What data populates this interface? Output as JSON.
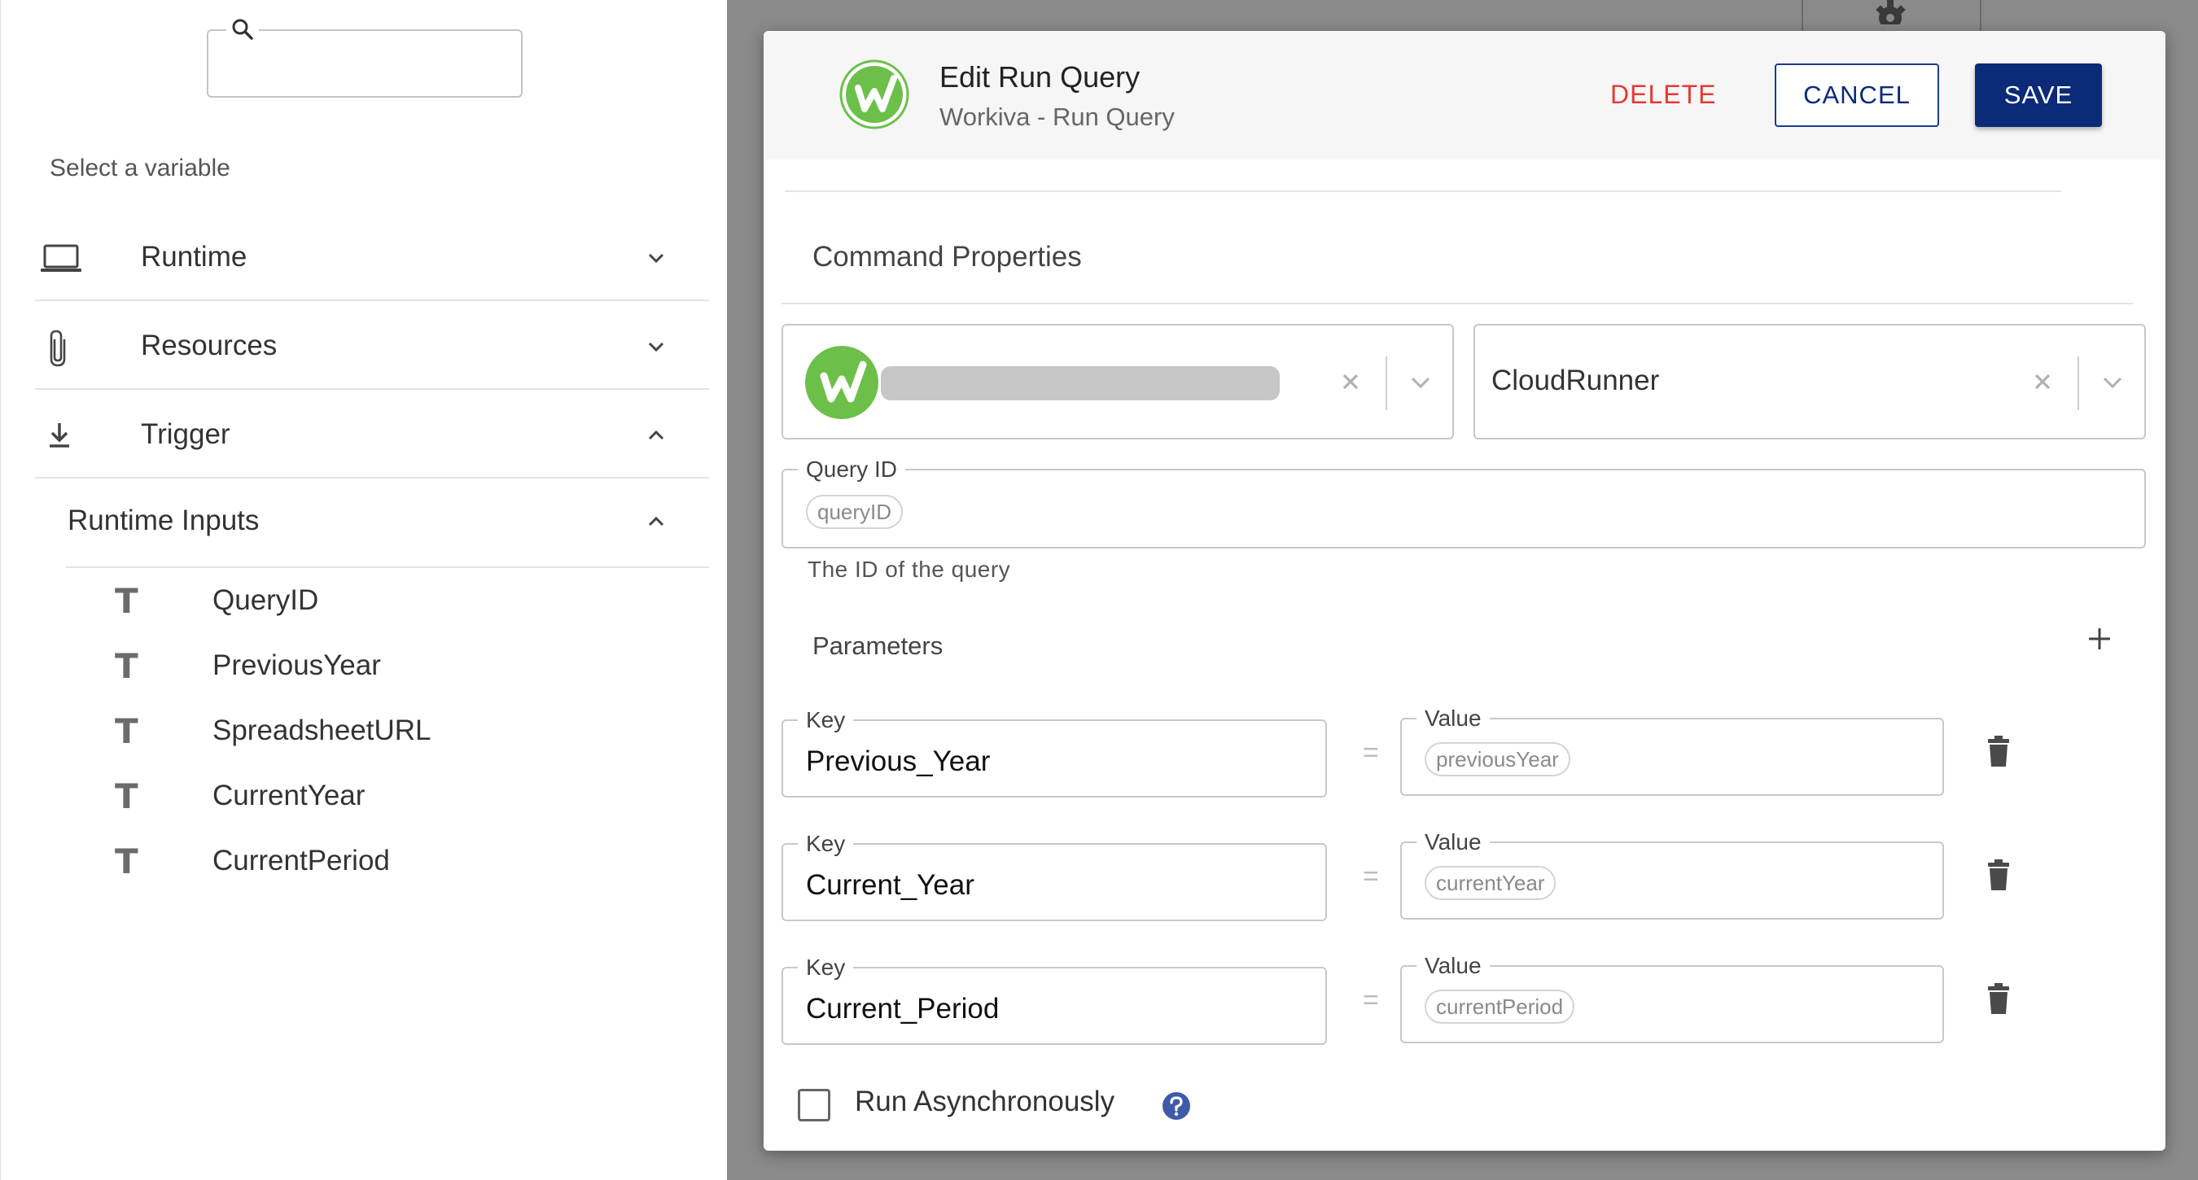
{
  "sidebar": {
    "search": {
      "value": "",
      "placeholder": ""
    },
    "select_label": "Select a variable",
    "sections": [
      {
        "label": "Runtime",
        "icon": "laptop-icon",
        "expanded": false
      },
      {
        "label": "Resources",
        "icon": "paperclip-icon",
        "expanded": false
      },
      {
        "label": "Trigger",
        "icon": "download-icon",
        "expanded": true
      }
    ],
    "runtime_inputs": {
      "label": "Runtime Inputs",
      "expanded": true,
      "items": [
        "QueryID",
        "PreviousYear",
        "SpreadsheetURL",
        "CurrentYear",
        "CurrentPeriod"
      ]
    }
  },
  "modal": {
    "title": "Edit Run Query",
    "subtitle": "Workiva - Run Query",
    "delete_label": "DELETE",
    "cancel_label": "CANCEL",
    "save_label": "SAVE",
    "section_title": "Command Properties",
    "account_value": "",
    "runner_value": "CloudRunner",
    "query_id": {
      "label": "Query ID",
      "chip": "queryID",
      "helper": "The ID of the query"
    },
    "parameters_label": "Parameters",
    "key_label": "Key",
    "value_label": "Value",
    "equals_symbol": "=",
    "parameters": [
      {
        "key": "Previous_Year",
        "value": "previousYear"
      },
      {
        "key": "Current_Year",
        "value": "currentYear"
      },
      {
        "key": "Current_Period",
        "value": "currentPeriod"
      }
    ],
    "run_async_label": "Run Asynchronously",
    "run_async_checked": false
  },
  "colors": {
    "brand_green": "#6cc04a",
    "primary_navy": "#0b2a78",
    "delete_red": "#e53935",
    "help_blue": "#3f5aa8"
  }
}
